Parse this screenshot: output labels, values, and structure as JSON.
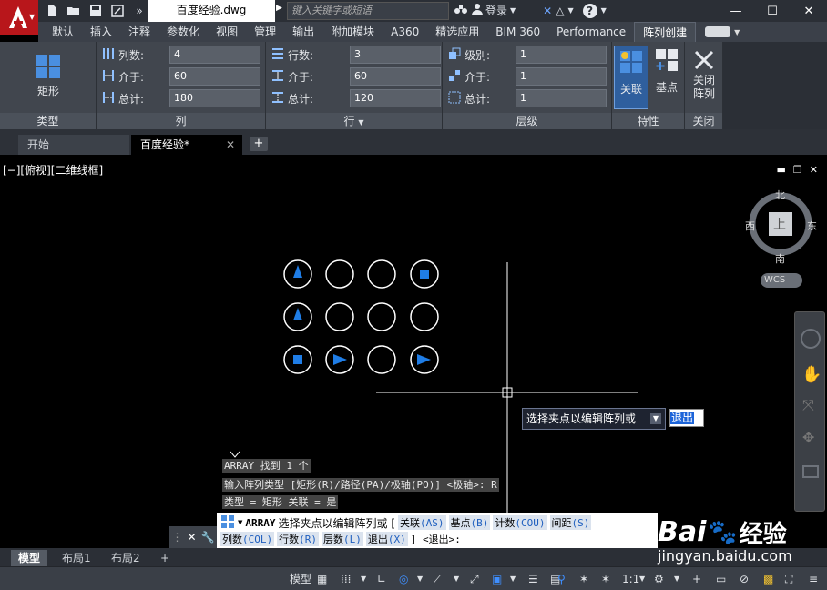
{
  "app": {
    "document_title": "百度经验.dwg",
    "search_placeholder": "键入关键字或短语",
    "login_label": "登录"
  },
  "ribbon_tabs": [
    "默认",
    "插入",
    "注释",
    "参数化",
    "视图",
    "管理",
    "输出",
    "附加模块",
    "A360",
    "精选应用",
    "BIM 360",
    "Performance",
    "阵列创建"
  ],
  "ribbon": {
    "type_panel": {
      "button": "矩形",
      "footer": "类型"
    },
    "columns_panel": {
      "footer": "列",
      "rows": [
        {
          "label": "列数:",
          "value": "4"
        },
        {
          "label": "介于:",
          "value": "60"
        },
        {
          "label": "总计:",
          "value": "180"
        }
      ]
    },
    "rows_panel": {
      "footer": "行",
      "rows": [
        {
          "label": "行数:",
          "value": "3"
        },
        {
          "label": "介于:",
          "value": "60"
        },
        {
          "label": "总计:",
          "value": "120"
        }
      ]
    },
    "levels_panel": {
      "footer": "层级",
      "rows": [
        {
          "label": "级别:",
          "value": "1"
        },
        {
          "label": "介于:",
          "value": "1"
        },
        {
          "label": "总计:",
          "value": "1"
        }
      ]
    },
    "props_panel": {
      "assoc": "关联",
      "base": "基点",
      "footer": "特性"
    },
    "close_panel": {
      "line1": "关闭",
      "line2": "阵列",
      "footer": "关闭"
    }
  },
  "doc_tabs": {
    "start": "开始",
    "current": "百度经验*"
  },
  "viewport": {
    "label": "[−][俯视][二维线框]",
    "compass": {
      "n": "北",
      "s": "南",
      "e": "东",
      "w": "西",
      "top": "上",
      "wcs": "WCS"
    }
  },
  "command_history": [
    "ARRAY 找到 1 个",
    "输入阵列类型 [矩形(R)/路径(PA)/极轴(PO)] <极轴>: R",
    "类型 = 矩形  关联 = 是"
  ],
  "tooltip": {
    "text": "选择夹点以编辑阵列或",
    "input": "退出"
  },
  "command_line": {
    "command": "ARRAY",
    "prompt": "选择夹点以编辑阵列或 [",
    "options_line1": [
      {
        "text": "关联",
        "key": "(AS)"
      },
      {
        "text": "基点",
        "key": "(B)"
      },
      {
        "text": "计数",
        "key": "(COU)"
      },
      {
        "text": "间距",
        "key": "(S)"
      }
    ],
    "options_line2": [
      {
        "text": "列数",
        "key": "(COL)"
      },
      {
        "text": "行数",
        "key": "(R)"
      },
      {
        "text": "层数",
        "key": "(L)"
      },
      {
        "text": "退出",
        "key": "(X)"
      }
    ],
    "suffix": "] <退出>:"
  },
  "layout_tabs": [
    "模型",
    "布局1",
    "布局2"
  ],
  "statusbar": {
    "model": "模型",
    "scale": "1:1"
  },
  "watermark": {
    "brand": "Bai",
    "brand2": "经验",
    "url": "jingyan.baidu.com"
  },
  "colors": {
    "accent": "#1f7de6",
    "app_red": "#b8161b"
  }
}
